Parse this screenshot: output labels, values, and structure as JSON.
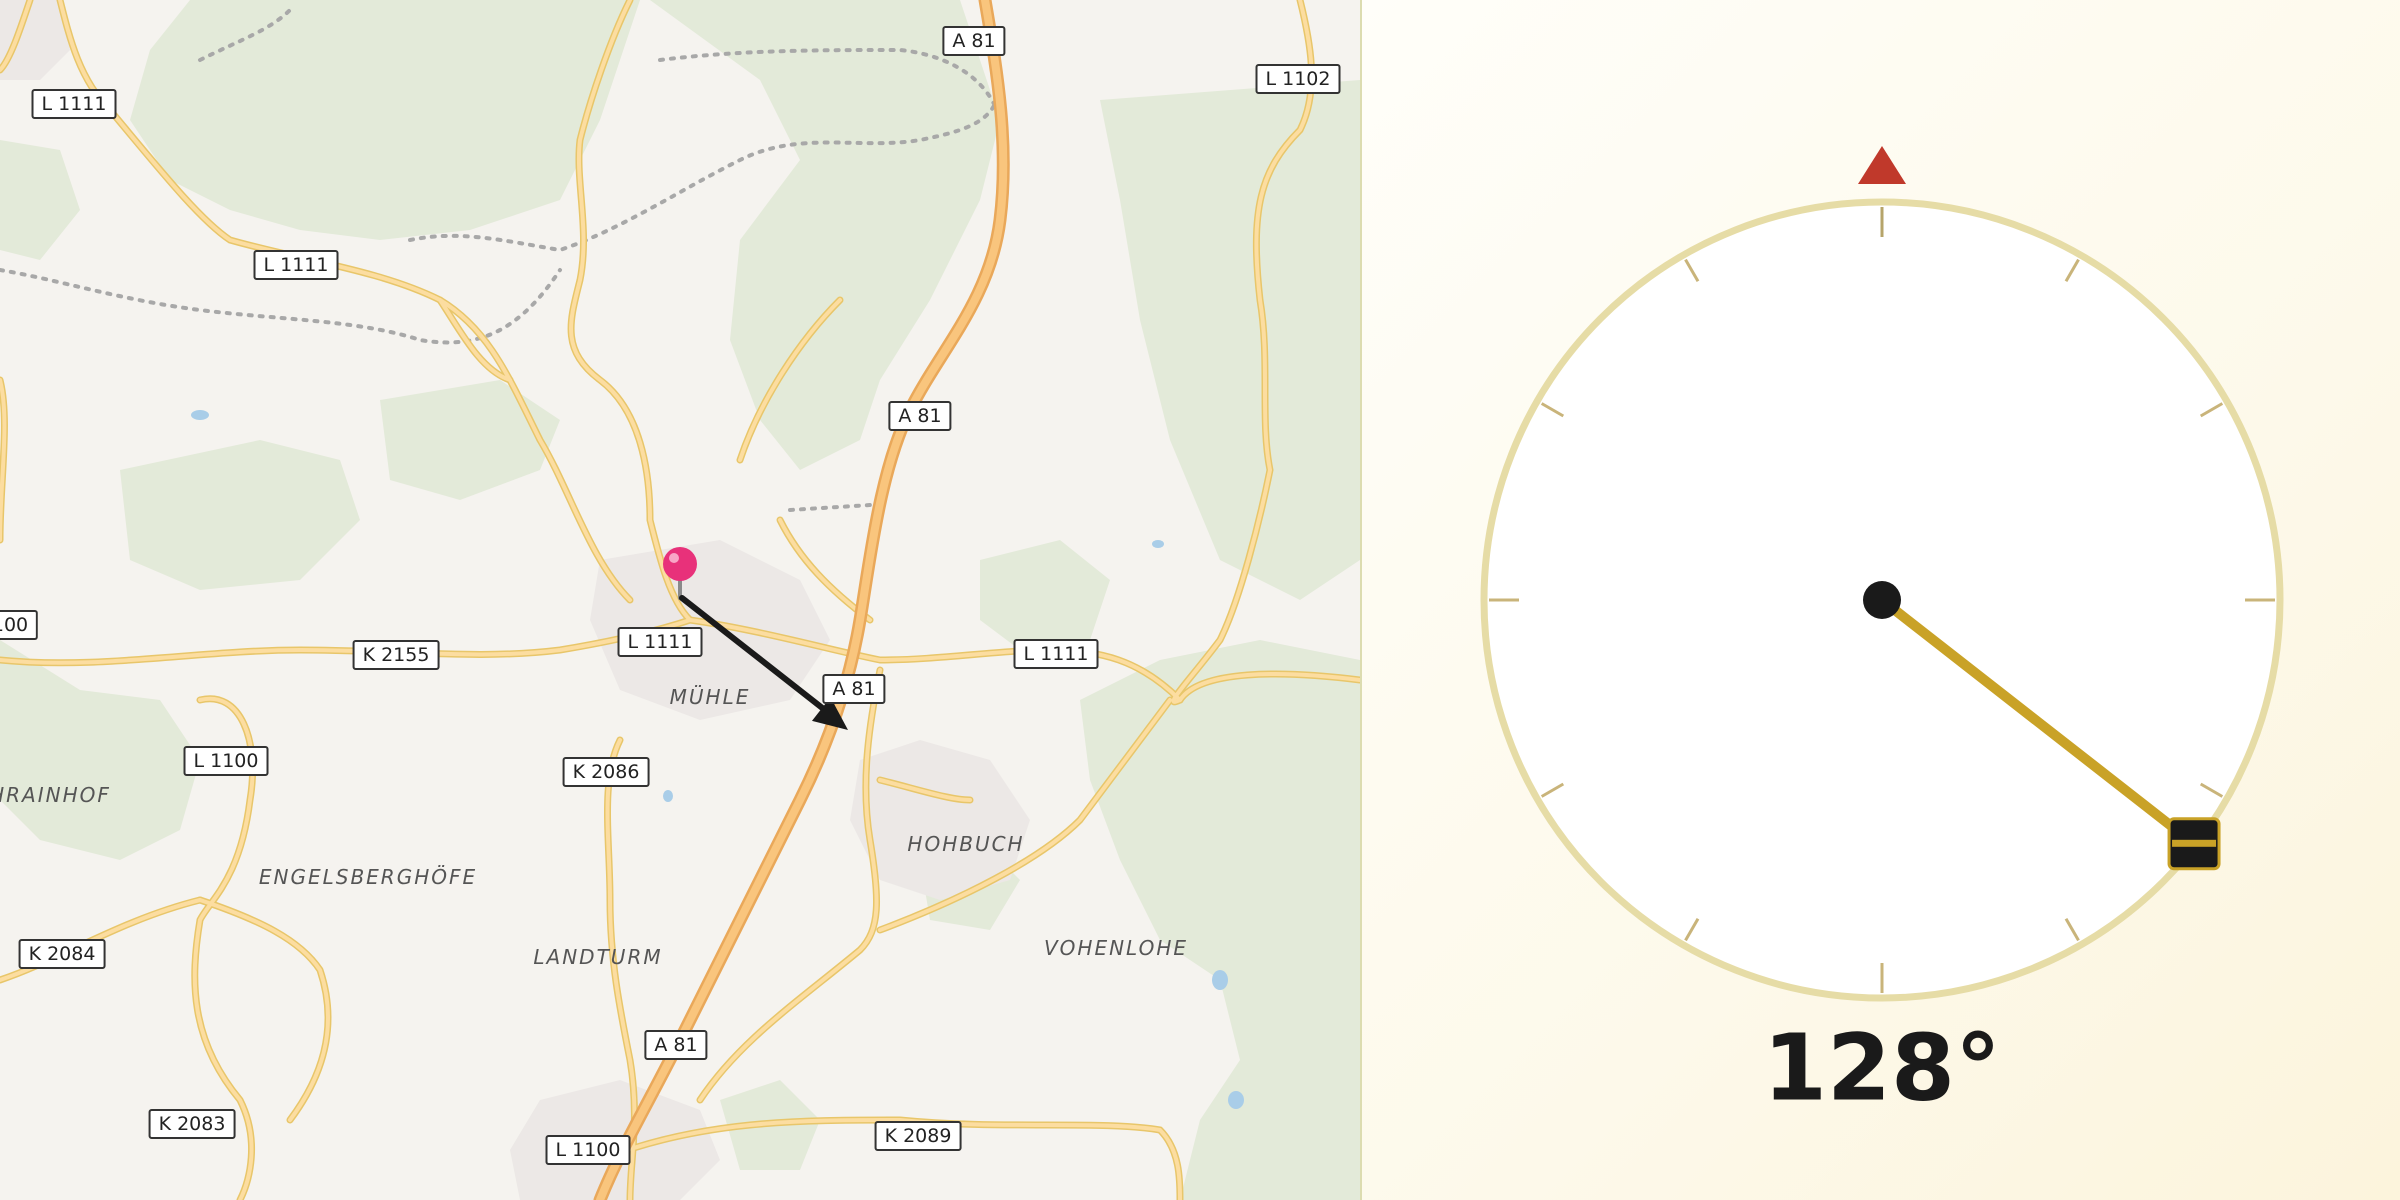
{
  "map": {
    "road_shields": [
      {
        "id": "a81-north",
        "label": "A 81"
      },
      {
        "id": "l1102",
        "label": "L 1102"
      },
      {
        "id": "l1111-nw",
        "label": "L 1111"
      },
      {
        "id": "l1111-w",
        "label": "L 1111"
      },
      {
        "id": "a81-mid",
        "label": "A 81"
      },
      {
        "id": "l1100-w-cut",
        "label": "100"
      },
      {
        "id": "k2155",
        "label": "K 2155"
      },
      {
        "id": "l1111-center",
        "label": "L 1111"
      },
      {
        "id": "a81-center",
        "label": "A 81"
      },
      {
        "id": "l1111-east",
        "label": "L 1111"
      },
      {
        "id": "l1100-w",
        "label": "L 1100"
      },
      {
        "id": "k2086",
        "label": "K 2086"
      },
      {
        "id": "k2084",
        "label": "K 2084"
      },
      {
        "id": "a81-south",
        "label": "A 81"
      },
      {
        "id": "k2083",
        "label": "K 2083"
      },
      {
        "id": "l1100-s",
        "label": "L 1100"
      },
      {
        "id": "k2089",
        "label": "K 2089"
      }
    ],
    "place_labels": [
      {
        "id": "muehle",
        "label": "MÜHLE"
      },
      {
        "id": "rainhof",
        "label": "HRAINHOF"
      },
      {
        "id": "hohbuch",
        "label": "HOHBUCH"
      },
      {
        "id": "engelsberghoefe",
        "label": "ENGELSBERGHÖFE"
      },
      {
        "id": "landturm",
        "label": "LANDTURM"
      },
      {
        "id": "vohenlohe",
        "label": "VOHENLOHE"
      }
    ],
    "marker_icon": "location-pin-icon",
    "direction_icon": "bearing-arrow-icon"
  },
  "compass": {
    "heading_degrees": 128,
    "heading_text": "128°",
    "north_marker_icon": "north-triangle-icon",
    "needle_icon": "compass-needle-icon",
    "colors": {
      "needle": "#c9a227",
      "north": "#c0392b",
      "dial_ring": "#e6dca6",
      "hub": "#1a1a1a"
    }
  }
}
